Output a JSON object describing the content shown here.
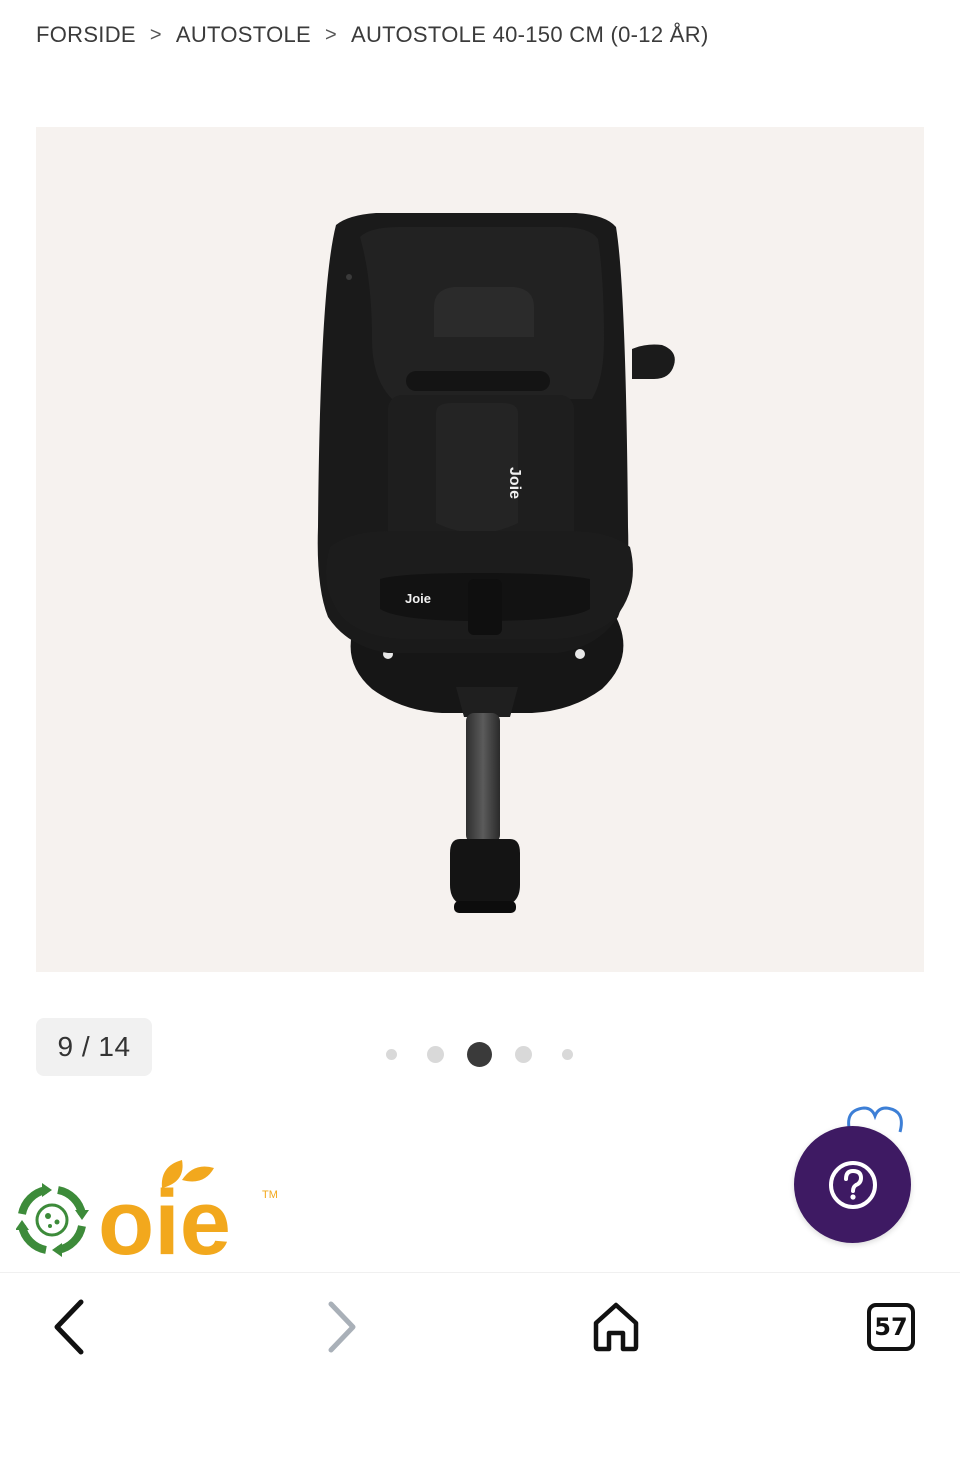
{
  "breadcrumb": {
    "items": [
      "FORSIDE",
      "AUTOSTOLE",
      "AUTOSTOLE 40-150 CM (0-12 ÅR)"
    ],
    "separator": ">"
  },
  "gallery": {
    "counter": "9 / 14",
    "image": "Joie car seat product photo",
    "product_brand_label": "Joie",
    "dots": {
      "count": 5,
      "active_index": 2
    },
    "background_color": "#f6f2ef"
  },
  "brand_logo": {
    "text": "oie",
    "trademark": "TM",
    "colors": {
      "text": "#f2a81d",
      "icon": "#3d8b3a"
    }
  },
  "help_button": {
    "icon": "question-icon",
    "color": "#3e1a63"
  },
  "favorite": {
    "icon": "heart-icon",
    "color": "#3d7fd6"
  },
  "toolbar": {
    "back_icon": "chevron-left-icon",
    "forward_icon": "chevron-right-icon",
    "home_icon": "home-icon",
    "tabs_count": "57"
  }
}
